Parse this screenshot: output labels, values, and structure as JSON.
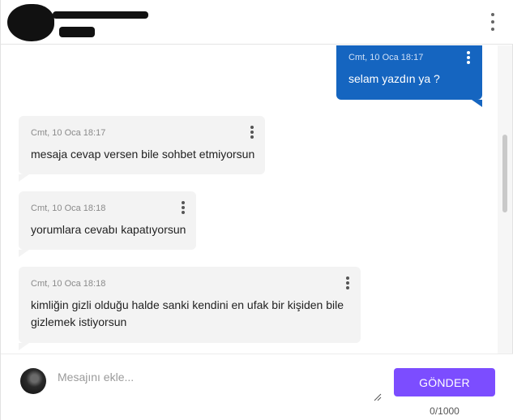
{
  "header": {
    "menu_icon": "more-vertical-icon"
  },
  "messages": [
    {
      "direction": "outgoing",
      "timestamp": "Cmt, 10 Oca 18:17",
      "text": "selam yazdın ya ?"
    },
    {
      "direction": "incoming",
      "timestamp": "Cmt, 10 Oca 18:17",
      "text": "mesaja cevap versen bile sohbet etmiyorsun"
    },
    {
      "direction": "incoming",
      "timestamp": "Cmt, 10 Oca 18:18",
      "text": "yorumlara cevabı kapatıyorsun"
    },
    {
      "direction": "incoming",
      "timestamp": "Cmt, 10 Oca 18:18",
      "text": "kimliğin gizli olduğu halde sanki kendini en ufak bir kişiden bile gizlemek istiyorsun"
    }
  ],
  "composer": {
    "placeholder": "Mesajını ekle...",
    "value": "",
    "send_label": "GÖNDER",
    "counter": "0/1000"
  },
  "colors": {
    "outgoing_bubble": "#1565c0",
    "incoming_bubble": "#f3f3f3",
    "send_button": "#7c4dff"
  }
}
